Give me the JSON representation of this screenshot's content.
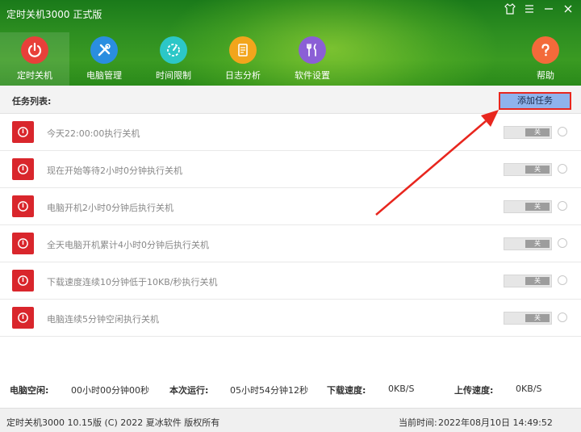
{
  "window": {
    "title": "定时关机3000 正式版",
    "controls": [
      "shirt-icon",
      "menu-icon",
      "minimize-icon",
      "close-icon"
    ]
  },
  "nav": [
    {
      "label": "定时关机",
      "icon": "power-icon",
      "color": "#e8403a",
      "active": true
    },
    {
      "label": "电脑管理",
      "icon": "tools-icon",
      "color": "#2a8ee0"
    },
    {
      "label": "时间限制",
      "icon": "timer-icon",
      "color": "#2cc7c7"
    },
    {
      "label": "日志分析",
      "icon": "log-icon",
      "color": "#f2a51c"
    },
    {
      "label": "软件设置",
      "icon": "settings-icon",
      "color": "#8b5fd6"
    },
    {
      "label": "帮助",
      "icon": "help-icon",
      "color": "#f36a3a"
    }
  ],
  "task_list": {
    "title": "任务列表:",
    "add_button": "添加任务",
    "tasks": [
      {
        "text": "今天22:00:00执行关机",
        "state": "关"
      },
      {
        "text": "现在开始等待2小时0分钟执行关机",
        "state": "关"
      },
      {
        "text": "电脑开机2小时0分钟后执行关机",
        "state": "关"
      },
      {
        "text": "全天电脑开机累计4小时0分钟后执行关机",
        "state": "关"
      },
      {
        "text": "下载速度连续10分钟低于10KB/秒执行关机",
        "state": "关"
      },
      {
        "text": "电脑连续5分钟空闲执行关机",
        "state": "关"
      }
    ]
  },
  "stats": {
    "idle_label": "电脑空闲:",
    "idle_value": "00小时00分钟00秒",
    "run_label": "本次运行:",
    "run_value": "05小时54分钟12秒",
    "download_label": "下载速度:",
    "download_value": "0KB/S",
    "upload_label": "上传速度:",
    "upload_value": "0KB/S"
  },
  "footer": {
    "copyright": "定时关机3000 10.15版 (C) 2022  夏冰软件 版权所有",
    "time_label": "当前时间:",
    "time_value": "2022年08月10日 14:49:52"
  },
  "colors": {
    "accent_red": "#d9262c",
    "header_green": "#2e8f21",
    "highlight": "#e8261e",
    "button_blue": "#8fb3ec"
  }
}
